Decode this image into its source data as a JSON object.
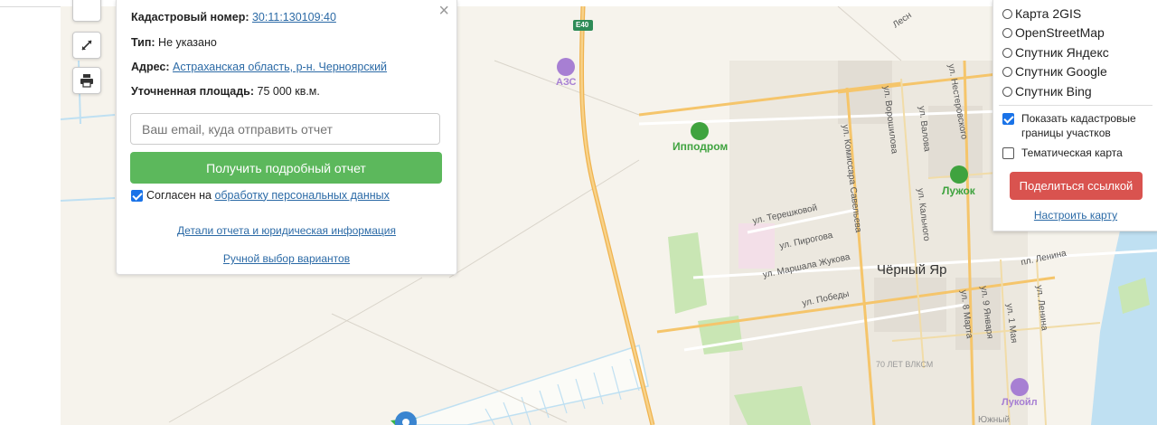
{
  "map": {
    "labels": {
      "e40": "E40",
      "azs": "АЗС",
      "ippodrom": "Ипподром",
      "luzhok": "Лужок",
      "lukoil": "Лукойл",
      "town": "Чёрный Яр",
      "vlksm": "70 ЛЕТ ВЛКСМ",
      "yuzhny": "Южный",
      "lesnaya": "Лесн"
    },
    "streets": {
      "tereshkovoy": "ул. Терешковой",
      "pirogova": "ул. Пирогова",
      "marshala": "ул. Маршала Жукова",
      "pobedy": "ул. Победы",
      "komissara": "ул. Комиссара Савельева",
      "voroshilova": "ул. Ворошилова",
      "valova": "ул. Валова",
      "nesterovskogo": "ул. Нестеровского",
      "kalnogo": "ул. Кального",
      "lenina_h": "пл. Ленина",
      "lenina_v": "ул. Ленина",
      "marta": "ул. 8 Марта",
      "yanvarya": "ул. 9 Января",
      "maya": "ул. 1 Мая"
    }
  },
  "controls": {
    "fullscreen_icon": "expand-icon",
    "print_icon": "printer-icon"
  },
  "info": {
    "cadastral_label": "Кадастровый номер:",
    "cadastral_value": "30:11:130109:40",
    "type_label": "Тип:",
    "type_value": "Не указано",
    "address_label": "Адрес:",
    "address_value": "Астраханская область, р-н. Черноярский",
    "area_label": "Уточненная площадь:",
    "area_value": "75 000 кв.м.",
    "close": "×",
    "email_placeholder": "Ваш email, куда отправить отчет",
    "report_button": "Получить подробный отчет",
    "consent_prefix": "Согласен на",
    "consent_link": "обработку персональных данных",
    "details_link": "Детали отчета и юридическая информация",
    "manual_link": "Ручной выбор вариантов"
  },
  "layers": {
    "options": [
      "Карта 2GIS",
      "OpenStreetMap",
      "Спутник Яндекс",
      "Спутник Google",
      "Спутник Bing"
    ],
    "show_cadastral": "Показать кадастровые границы участков",
    "show_cadastral_checked": true,
    "thematic": "Тематическая карта",
    "thematic_checked": false,
    "share_button": "Поделиться ссылкой",
    "configure_link": "Настроить карту"
  },
  "colors": {
    "report_button": "#5cb85c",
    "share_button": "#d9534f",
    "link": "#2b6aa6",
    "road_major": "#f5c56b",
    "park": "#c9e6b4",
    "water": "#bfe0f2",
    "poi_purple": "#a77fd3",
    "poi_green": "#3fa33f",
    "marker": "#3a85d0"
  }
}
